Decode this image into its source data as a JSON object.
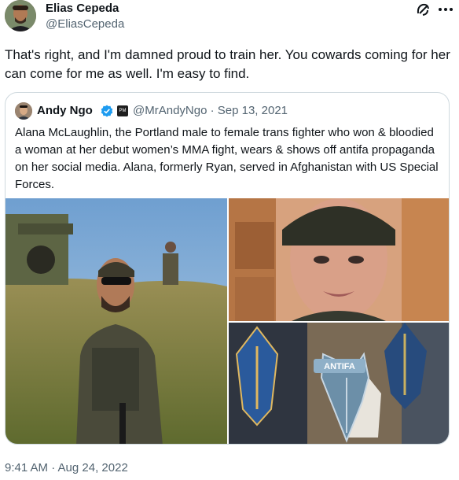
{
  "author": {
    "name": "Elias Cepeda",
    "handle": "@EliasCepeda"
  },
  "tweet": {
    "text": "That's right, and I'm damned proud to train her. You cowards coming for her can come for me as well. I'm easy to find."
  },
  "quote": {
    "name": "Andy Ngo",
    "handle_time": "@MrAndyNgo · Sep 13, 2021",
    "badge_text": "PM",
    "text": "Alana McLaughlin, the Portland male to female trans fighter who won & bloodied a woman at her debut women’s MMA fight, wears & shows off antifa propaganda on her social media. Alana, formerly Ryan, served in Afghanistan with US Special Forces.",
    "patch_text": "ANTIFA"
  },
  "timestamp": "9:41 AM · Aug 24, 2022",
  "colors": {
    "text": "#0f1419",
    "secondary": "#536471",
    "border": "#cfd9de",
    "verified": "#1d9bf0"
  },
  "icons": {
    "action": "grok-icon",
    "more": "more-icon",
    "verified": "verified-badge-icon"
  }
}
